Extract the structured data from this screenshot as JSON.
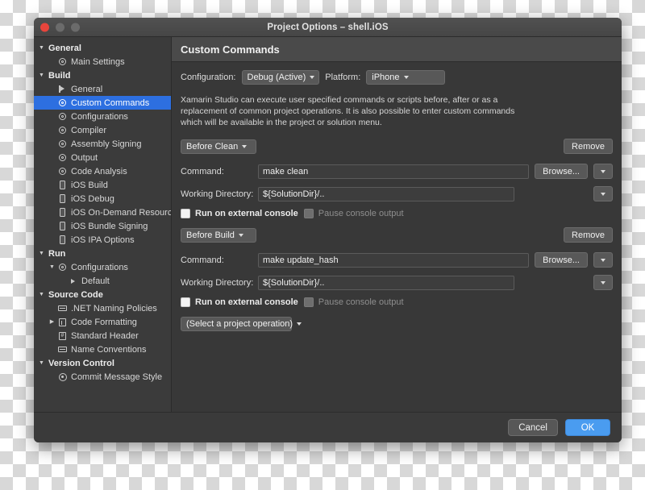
{
  "window": {
    "title": "Project Options – shell.iOS",
    "traffic": {
      "close": "close-button",
      "minimize": "minimize-button",
      "maximize": "maximize-button"
    }
  },
  "sidebar": {
    "items": [
      {
        "label": "General",
        "level": 0,
        "type": "group",
        "icon": "disclosure-open",
        "selected": false
      },
      {
        "label": "Main Settings",
        "level": 1,
        "type": "item",
        "icon": "gear-icon",
        "selected": false
      },
      {
        "label": "Build",
        "level": 0,
        "type": "group",
        "icon": "disclosure-open",
        "selected": false
      },
      {
        "label": "General",
        "level": 1,
        "type": "item",
        "icon": "flag-icon",
        "selected": false
      },
      {
        "label": "Custom Commands",
        "level": 1,
        "type": "item",
        "icon": "gear-icon",
        "selected": true
      },
      {
        "label": "Configurations",
        "level": 1,
        "type": "item",
        "icon": "gear-icon",
        "selected": false
      },
      {
        "label": "Compiler",
        "level": 1,
        "type": "item",
        "icon": "gear-icon",
        "selected": false
      },
      {
        "label": "Assembly Signing",
        "level": 1,
        "type": "item",
        "icon": "gear-icon",
        "selected": false
      },
      {
        "label": "Output",
        "level": 1,
        "type": "item",
        "icon": "gear-icon",
        "selected": false
      },
      {
        "label": "Code Analysis",
        "level": 1,
        "type": "item",
        "icon": "gear-icon",
        "selected": false
      },
      {
        "label": "iOS Build",
        "level": 1,
        "type": "item",
        "icon": "phone-icon",
        "selected": false
      },
      {
        "label": "iOS Debug",
        "level": 1,
        "type": "item",
        "icon": "phone-icon",
        "selected": false
      },
      {
        "label": "iOS On-Demand Resources",
        "level": 1,
        "type": "item",
        "icon": "phone-icon",
        "selected": false
      },
      {
        "label": "iOS Bundle Signing",
        "level": 1,
        "type": "item",
        "icon": "phone-icon",
        "selected": false
      },
      {
        "label": "iOS IPA Options",
        "level": 1,
        "type": "item",
        "icon": "phone-icon",
        "selected": false
      },
      {
        "label": "Run",
        "level": 0,
        "type": "group",
        "icon": "disclosure-open",
        "selected": false
      },
      {
        "label": "Configurations",
        "level": 1,
        "type": "parent",
        "icon": "gear-icon",
        "selected": false
      },
      {
        "label": "Default",
        "level": 2,
        "type": "item",
        "icon": "triangle-icon",
        "selected": false
      },
      {
        "label": "Source Code",
        "level": 0,
        "type": "group",
        "icon": "disclosure-open",
        "selected": false
      },
      {
        "label": ".NET Naming Policies",
        "level": 1,
        "type": "item",
        "icon": "card-icon",
        "selected": false
      },
      {
        "label": "Code Formatting",
        "level": 1,
        "type": "closed",
        "icon": "document-icon",
        "selected": false
      },
      {
        "label": "Standard Header",
        "level": 1,
        "type": "item",
        "icon": "header-icon",
        "selected": false
      },
      {
        "label": "Name Conventions",
        "level": 1,
        "type": "item",
        "icon": "card-icon",
        "selected": false
      },
      {
        "label": "Version Control",
        "level": 0,
        "type": "group",
        "icon": "disclosure-open",
        "selected": false
      },
      {
        "label": "Commit Message Style",
        "level": 1,
        "type": "item",
        "icon": "target-icon",
        "selected": false
      }
    ]
  },
  "content": {
    "header_title": "Custom Commands",
    "configuration_label": "Configuration:",
    "configuration_value": "Debug (Active)",
    "platform_label": "Platform:",
    "platform_value": "iPhone",
    "description": "Xamarin Studio can execute user specified commands or scripts before, after or as a replacement of common project operations. It is also possible to enter custom commands which will be available in the project or solution menu.",
    "command_label": "Command:",
    "working_directory_label": "Working Directory:",
    "browse_label": "Browse...",
    "remove_label": "Remove",
    "run_external_label": "Run on external console",
    "pause_output_label": "Pause console output",
    "blocks": [
      {
        "operation": "Before Clean",
        "command": "make clean",
        "working_directory": "${SolutionDir}/..",
        "run_on_external_console": false,
        "pause_console_output": false
      },
      {
        "operation": "Before Build",
        "command": "make update_hash",
        "working_directory": "${SolutionDir}/..",
        "run_on_external_console": false,
        "pause_console_output": false
      }
    ],
    "add_operation_placeholder": "(Select a project operation)"
  },
  "footer": {
    "cancel_label": "Cancel",
    "ok_label": "OK"
  },
  "colors": {
    "selection_blue": "#2d6fe0",
    "primary_button_blue": "#4a9cf0",
    "window_background": "#3a3a3a",
    "content_background": "#383838",
    "sidebar_background": "#3b3b3b",
    "close_button_red": "#e8453c"
  }
}
